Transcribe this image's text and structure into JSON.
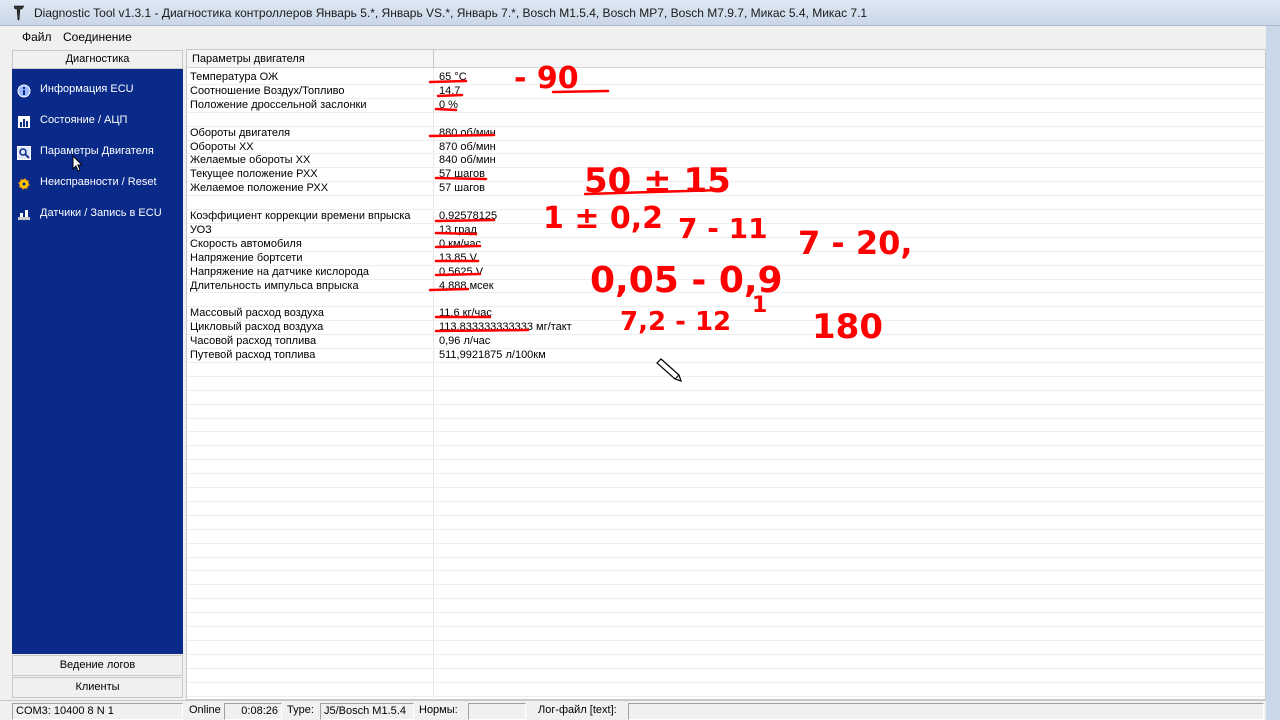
{
  "window": {
    "title": "Diagnostic Tool v1.3.1 - Диагностика контроллеров Январь 5.*, Январь VS.*, Январь 7.*, Bosch M1.5.4, Bosch MP7, Bosch M7.9.7, Микас 5.4, Микас 7.1",
    "icon": "tuning-fork-icon"
  },
  "menu": {
    "file": "Файл",
    "connection": "Соединение"
  },
  "sidebar": {
    "header": "Диагностика",
    "items": [
      {
        "label": "Информация ECU",
        "icon": "info-icon"
      },
      {
        "label": "Состояние / АЦП",
        "icon": "chart-icon"
      },
      {
        "label": "Параметры Двигателя",
        "icon": "magnifier-icon"
      },
      {
        "label": "Неисправности / Reset",
        "icon": "gear-warning-icon"
      },
      {
        "label": "Датчики / Запись в ECU",
        "icon": "sensor-write-icon"
      }
    ],
    "footer_logs": "Ведение логов",
    "footer_clients": "Клиенты"
  },
  "params": {
    "header": "Параметры двигателя",
    "rows": [
      {
        "name": "Температура ОЖ",
        "value": "65 °C"
      },
      {
        "name": "Соотношение Воздух/Топливо",
        "value": "14.7"
      },
      {
        "name": "Положение дроссельной заслонки",
        "value": "0 %"
      },
      {
        "name": "",
        "value": ""
      },
      {
        "name": "Обороты двигателя",
        "value": "880 об/мин"
      },
      {
        "name": "Обороты ХХ",
        "value": "870 об/мин"
      },
      {
        "name": "Желаемые обороты ХХ",
        "value": "840 об/мин"
      },
      {
        "name": "Текущее положение РХХ",
        "value": "57 шагов"
      },
      {
        "name": "Желаемое положение РХХ",
        "value": "57 шагов"
      },
      {
        "name": "",
        "value": ""
      },
      {
        "name": "Коэффициент коррекции времени впрыска",
        "value": "0,92578125"
      },
      {
        "name": "УОЗ",
        "value": "13 град"
      },
      {
        "name": "Скорость автомобиля",
        "value": "0 км/час"
      },
      {
        "name": "Напряжение бортсети",
        "value": "13,85 V"
      },
      {
        "name": "Напряжение на датчике кислорода",
        "value": "0,5625 V"
      },
      {
        "name": "Длительность импульса впрыска",
        "value": "4,888 мсек"
      },
      {
        "name": "",
        "value": ""
      },
      {
        "name": "Массовый расход воздуха",
        "value": "11,6 кг/час"
      },
      {
        "name": "Цикловый расход воздуха",
        "value": "113,833333333333 мг/такт"
      },
      {
        "name": "Часовой расход топлива",
        "value": "0,96 л/час"
      },
      {
        "name": "Путевой расход топлива",
        "value": "511,9921875 л/100км"
      }
    ]
  },
  "status": {
    "port": "COM3: 10400 8 N 1",
    "online": "Online",
    "time": "0:08:26",
    "type_label": "Type:",
    "type_value": "J5/Bosch M1.5.4",
    "norms_label": "Нормы:",
    "norms_value": "",
    "log_label": "Лог-файл [text]:",
    "log_value": ""
  },
  "annotations": {
    "color": "#ff0000",
    "handwritten": [
      "- 90",
      "50 ± 15",
      "1 ± 0,2",
      "7 - 11",
      "7 - 20,",
      "0,05 - 0,9",
      "1",
      "7,2 - 12",
      "180"
    ]
  }
}
